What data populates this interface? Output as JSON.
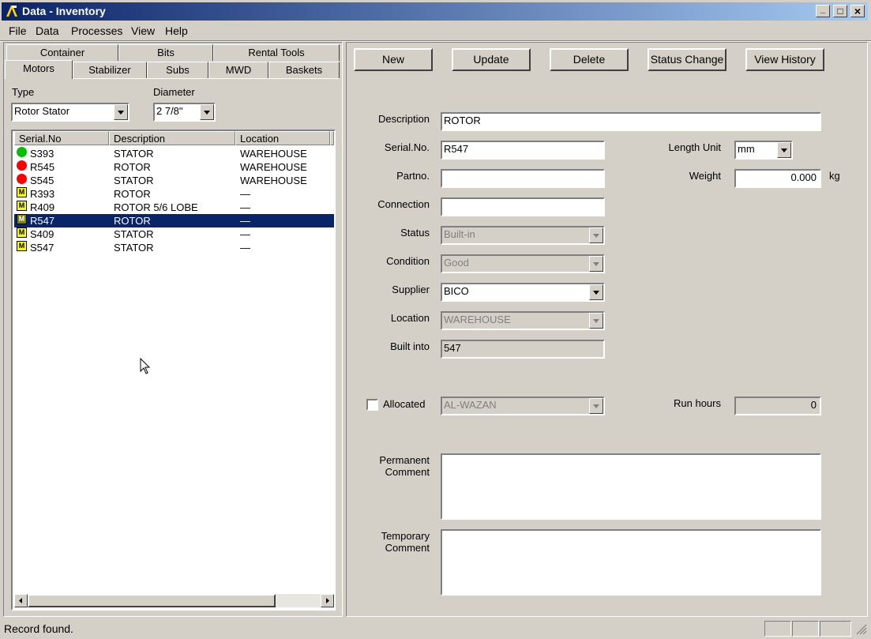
{
  "window": {
    "title": "Data - Inventory",
    "min": "_",
    "max": "□",
    "close": "×"
  },
  "menu": [
    "File",
    "Data",
    "Processes",
    "View",
    "Help"
  ],
  "tabs_back": [
    "Container",
    "Bits",
    "Rental Tools"
  ],
  "tabs_front": [
    "Motors",
    "Stabilizer",
    "Subs",
    "MWD",
    "Baskets"
  ],
  "filters": {
    "type_label": "Type",
    "type_value": "Rotor Stator",
    "diameter_label": "Diameter",
    "diameter_value": "2 7/8\""
  },
  "list": {
    "columns": [
      "Serial.No",
      "Description",
      "Location"
    ],
    "rows": [
      {
        "icon": "green-dot",
        "serial": "S393",
        "desc": "STATOR",
        "loc": "WAREHOUSE"
      },
      {
        "icon": "red-dot",
        "serial": "R545",
        "desc": "ROTOR",
        "loc": "WAREHOUSE"
      },
      {
        "icon": "red-dot",
        "serial": "S545",
        "desc": "STATOR",
        "loc": "WAREHOUSE"
      },
      {
        "icon": "m-badge",
        "serial": "R393",
        "desc": "ROTOR",
        "loc": "—"
      },
      {
        "icon": "m-badge",
        "serial": "R409",
        "desc": "ROTOR 5/6 LOBE",
        "loc": "—"
      },
      {
        "icon": "m-badge",
        "serial": "R547",
        "desc": "ROTOR",
        "loc": "—",
        "selected": true
      },
      {
        "icon": "m-badge",
        "serial": "S409",
        "desc": "STATOR",
        "loc": "—"
      },
      {
        "icon": "m-badge",
        "serial": "S547",
        "desc": "STATOR",
        "loc": "—"
      }
    ],
    "badge_letter": "M"
  },
  "toolbar": {
    "new": "New",
    "update": "Update",
    "delete": "Delete",
    "status_change": "Status Change",
    "view_history": "View History"
  },
  "form": {
    "description_label": "Description",
    "description": "ROTOR",
    "serial_label": "Serial.No.",
    "serial": "R547",
    "partno_label": "Partno.",
    "partno": "",
    "connection_label": "Connection",
    "connection": "",
    "status_label": "Status",
    "status": "Built-in",
    "condition_label": "Condition",
    "condition": "Good",
    "supplier_label": "Supplier",
    "supplier": "BICO",
    "location_label": "Location",
    "location": "WAREHOUSE",
    "builtinto_label": "Built into",
    "builtinto": "547",
    "length_unit_label": "Length Unit",
    "length_unit": "mm",
    "weight_label": "Weight",
    "weight": "0.000",
    "weight_unit": "kg",
    "allocated_label": "Allocated",
    "allocated_value": "AL-WAZAN",
    "run_hours_label": "Run hours",
    "run_hours": "0",
    "permanent_comment_label_1": "Permanent",
    "permanent_comment_label_2": "Comment",
    "temporary_comment_label_1": "Temporary",
    "temporary_comment_label_2": "Comment"
  },
  "status": {
    "text": "Record found."
  },
  "colors": {
    "titlebar": "#0a246a",
    "selection": "#0a246a",
    "green": "#00c000",
    "red": "#ff0000",
    "badge": "#ffff00"
  }
}
